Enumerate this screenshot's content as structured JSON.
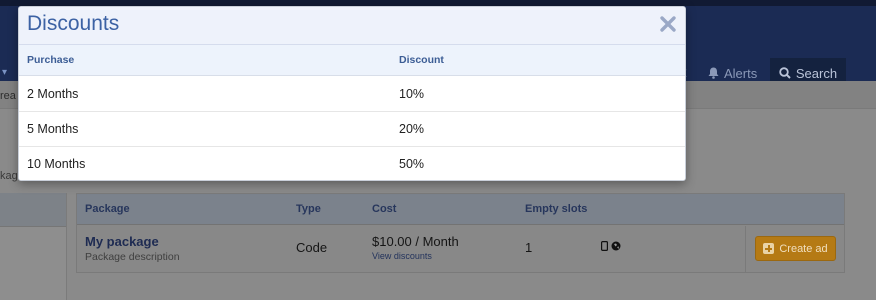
{
  "navbar": {
    "alerts_label": "Alerts",
    "search_label": "Search",
    "x_glyph": "x",
    "left_caret": "▾"
  },
  "background": {
    "subbar_fragment": "rea",
    "content_fragment": "kag"
  },
  "package_table": {
    "headers": {
      "package": "Package",
      "type": "Type",
      "cost": "Cost",
      "empty_slots": "Empty slots"
    },
    "row": {
      "name": "My package",
      "description": "Package description",
      "type": "Code",
      "cost": "$10.00 / Month",
      "view_discounts": "View discounts",
      "empty_slots": "1",
      "icons": [
        "mobile-icon",
        "globe-icon"
      ],
      "create_label": "Create ad"
    }
  },
  "modal": {
    "title": "Discounts",
    "close_icon": "close-icon",
    "columns": {
      "purchase": "Purchase",
      "discount": "Discount"
    },
    "rows": [
      {
        "purchase": "2 Months",
        "discount": "10%"
      },
      {
        "purchase": "5 Months",
        "discount": "20%"
      },
      {
        "purchase": "10 Months",
        "discount": "50%"
      }
    ]
  },
  "colors": {
    "modal_title": "#3c62a4",
    "header_text": "#3c5d95",
    "create_button": "#b57a14",
    "navbar": "#1b2b54"
  }
}
